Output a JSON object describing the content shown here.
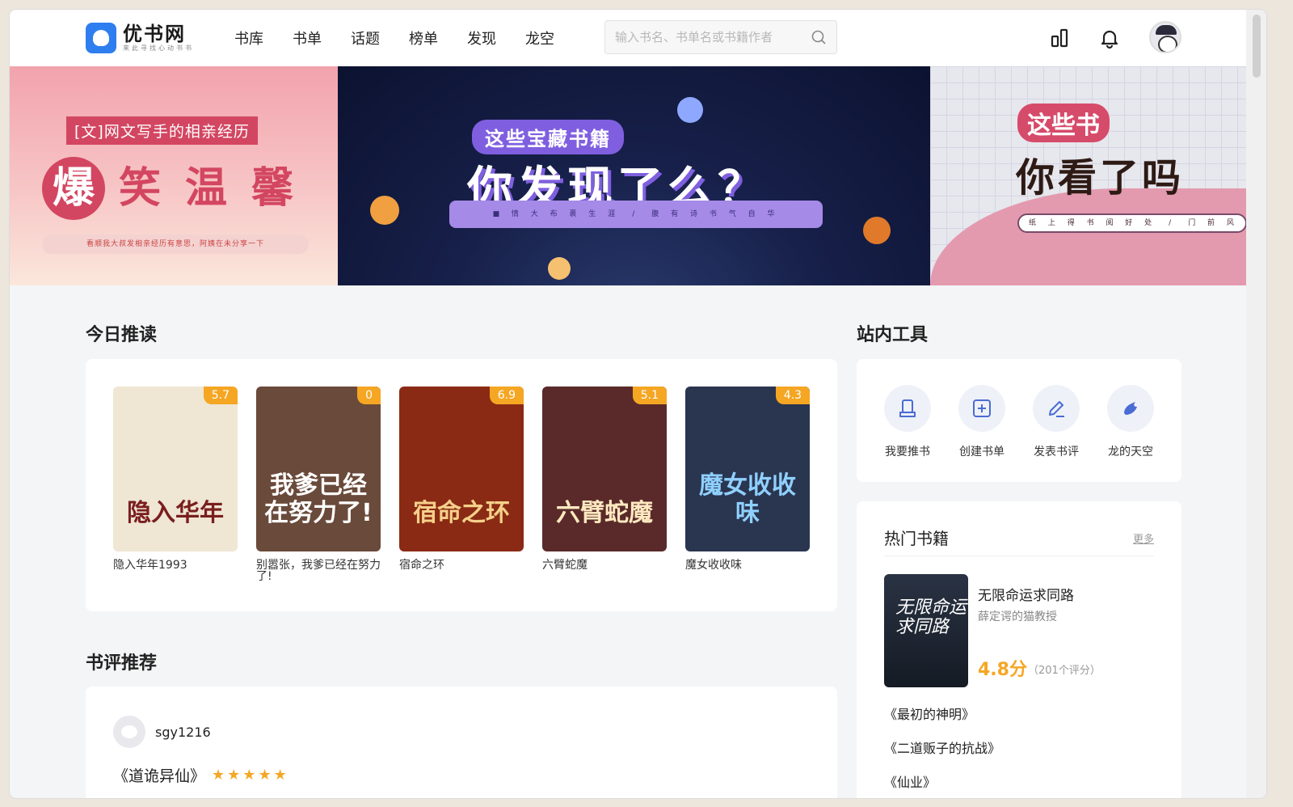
{
  "logo": {
    "title": "优书网",
    "subtitle": "来此寻找心动书书"
  },
  "nav": [
    "书库",
    "书单",
    "话题",
    "榜单",
    "发现",
    "龙空"
  ],
  "search": {
    "placeholder": "输入书名、书单名或书籍作者"
  },
  "banners": [
    {
      "tag": "[文]网文写手的相亲经历",
      "title": [
        "爆",
        "笑",
        "温",
        "馨"
      ],
      "bar": "看顺我大叔发相亲经历有意思，阿姨在未分享一下"
    },
    {
      "tag": "这些宝藏书籍",
      "title": "你发现了么？",
      "bar": "■ 情 大 布 裹 生 涯　/　腹 有 诗 书 气 自 华"
    },
    {
      "tag": "这些书",
      "title": "你看了吗",
      "bar": "纸 上 得 书 阅 好 处　/　门 前 风 景 雨"
    }
  ],
  "today": {
    "title": "今日推读",
    "books": [
      {
        "name": "隐入华年1993",
        "score": "5.7",
        "cover_text": "隐入华年",
        "bg": "#efe6d4",
        "fg": "#7a1e1e"
      },
      {
        "name": "别嚣张，我爹已经在努力了!",
        "score": "0",
        "cover_text": "我爹已经在努力了!",
        "bg": "#6a4a3a",
        "fg": "#ffffff"
      },
      {
        "name": "宿命之环",
        "score": "6.9",
        "cover_text": "宿命之环",
        "bg": "#8a2a14",
        "fg": "#f5d08a"
      },
      {
        "name": "六臂蛇魔",
        "score": "5.1",
        "cover_text": "六臂蛇魔",
        "bg": "#5a2a2a",
        "fg": "#ffe9c0"
      },
      {
        "name": "魔女收收味",
        "score": "4.3",
        "cover_text": "魔女收收味",
        "bg": "#2a3550",
        "fg": "#8fd0ff"
      }
    ]
  },
  "tools": {
    "title": "站内工具",
    "items": [
      {
        "label": "我要推书",
        "icon": "book-stand-icon"
      },
      {
        "label": "创建书单",
        "icon": "plus-square-icon"
      },
      {
        "label": "发表书评",
        "icon": "pen-icon"
      },
      {
        "label": "龙的天空",
        "icon": "dragon-icon"
      }
    ]
  },
  "hot": {
    "title": "热门书籍",
    "more": "更多",
    "featured": {
      "name": "无限命运求同路",
      "author": "薛定谔的猫教授",
      "score": "4.8分",
      "count": "（201个评分）",
      "cover_text": "无限命运求同路"
    },
    "list": [
      "《最初的神明》",
      "《二道贩子的抗战》",
      "《仙业》"
    ]
  },
  "reviews": {
    "title": "书评推荐",
    "first": {
      "user": "sgy1216",
      "book": "《道诡异仙》",
      "stars": 5
    }
  },
  "colors": {
    "accent": "#2e7ef0",
    "score_badge": "#f5a623"
  }
}
